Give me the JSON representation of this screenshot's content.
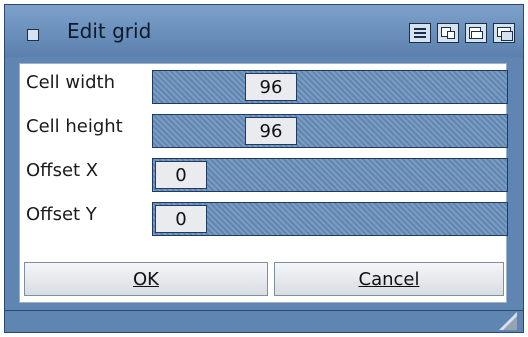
{
  "window": {
    "title": "Edit grid",
    "colors": {
      "titlebar": "#5f86b3",
      "panel": "#ffffff",
      "slider_track": "#5f86b3"
    }
  },
  "fields": [
    {
      "label": "Cell width",
      "value": "96"
    },
    {
      "label": "Cell height",
      "value": "96"
    },
    {
      "label": "Offset X",
      "value": "0"
    },
    {
      "label": "Offset Y",
      "value": "0"
    }
  ],
  "buttons": {
    "ok": {
      "label": "OK"
    },
    "cancel": {
      "label": "Cancel"
    }
  },
  "icons": {
    "close": "close-gadget-icon",
    "depth": "depth-gadget-icon",
    "zoom": "zoom-gadget-icon",
    "iconify": "iconify-gadget-icon",
    "back": "back-gadget-icon",
    "size": "size-gadget-icon"
  }
}
